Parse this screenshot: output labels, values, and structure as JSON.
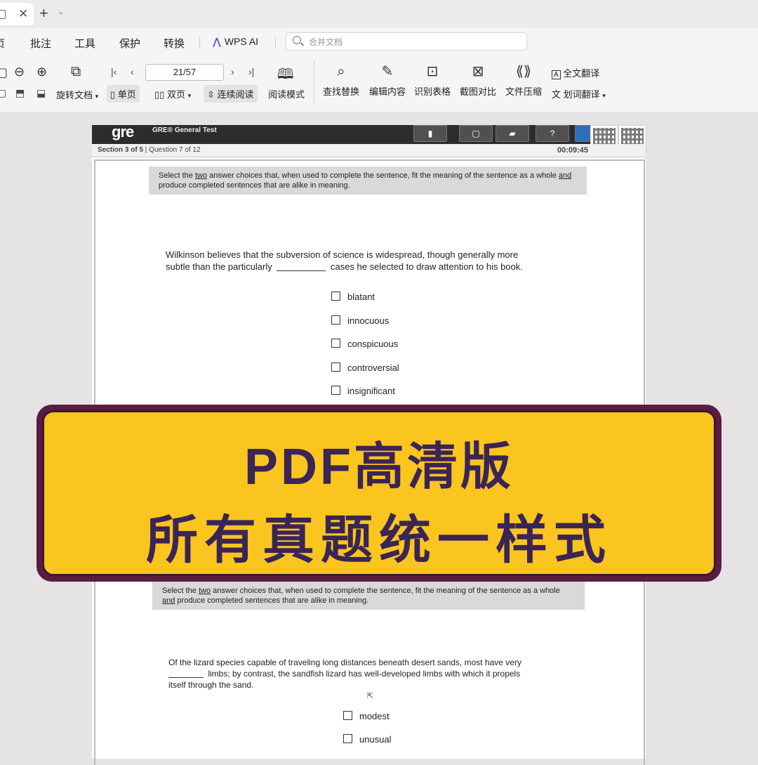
{
  "tab": {
    "close_glyph": "✕",
    "new_glyph": "+",
    "menu_glyph": "⌄"
  },
  "menu": {
    "items": [
      "页",
      "批注",
      "工具",
      "保护",
      "转换"
    ],
    "wps_ai": "WPS AI",
    "search_placeholder": "合并文档"
  },
  "toolbar": {
    "page_indicator": "21/57",
    "rotate_label": "旋转文档",
    "single_page": "单页",
    "double_page": "双页",
    "continuous": "连续阅读",
    "reading_mode": "阅读模式",
    "find_replace": "查找替换",
    "edit_content": "编辑内容",
    "recognize_table": "识别表格",
    "screenshot_compare": "截图对比",
    "file_compress": "文件压缩",
    "full_translate": "全文翻译",
    "word_translate": "划词翻译",
    "full_translate_icon": "A",
    "word_translate_icon": "文"
  },
  "gre": {
    "logo": "gre",
    "title": "GRE® General Test",
    "section": "Section 3 of 5",
    "question": "Question 7 of 12",
    "timer": "00:09:45"
  },
  "q1": {
    "instr_a": "Select the ",
    "instr_two": "two",
    "instr_b": " answer choices that, when used to complete the sentence, fit the meaning of the sentence as a whole ",
    "instr_and": "and",
    "instr_c": " produce completed sentences that are alike in meaning.",
    "line1": "Wilkinson believes that the subversion of science is widespread, though generally more",
    "line2a": "subtle than the particularly ",
    "line2b": " cases he selected to draw attention to his book.",
    "choices": [
      "blatant",
      "innocuous",
      "conspicuous",
      "controversial",
      "insignificant"
    ]
  },
  "q2": {
    "instr_a": "Select the ",
    "instr_two": "two",
    "instr_b": " answer choices that, when used to complete the sentence, fit the meaning of the sentence as a whole ",
    "instr_and": "and",
    "instr_c": " produce completed sentences that are alike in meaning.",
    "line1": "Of the lizard species capable of traveling long distances beneath desert sands, most have very",
    "line2b": " limbs; by contrast, the sandfish lizard has well-developed limbs with which it propels",
    "line3": "itself through the sand.",
    "choices": [
      "modest",
      "unusual"
    ]
  },
  "banner": {
    "line1": "PDF高清版",
    "line2": "所有真题统一样式"
  }
}
